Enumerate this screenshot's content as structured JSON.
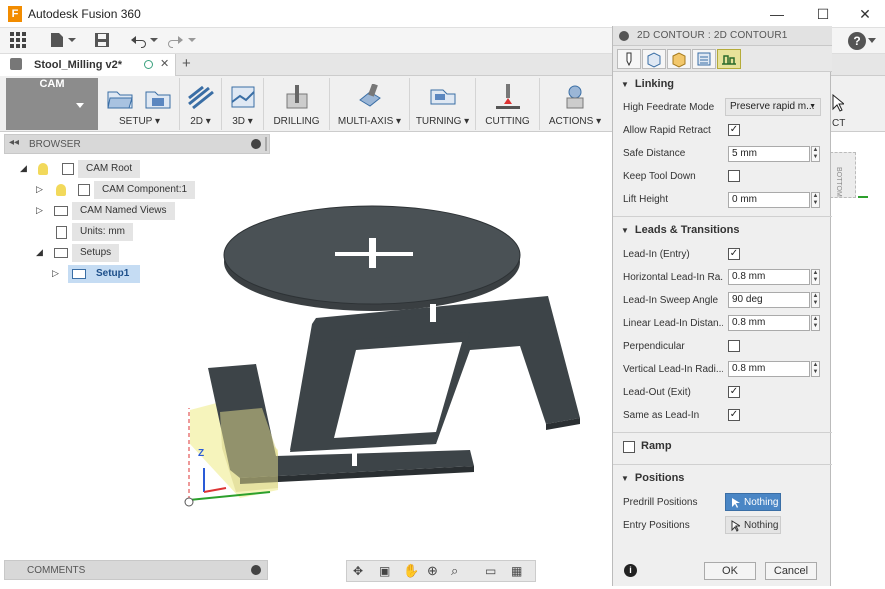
{
  "app": {
    "logo": "F",
    "title": "Autodesk Fusion 360",
    "minimize": "—",
    "maximize": "☐",
    "close": "✕"
  },
  "quick_toolbar": {
    "help": "?"
  },
  "document_tab": {
    "name": "Stool_Milling v2*",
    "close": "✕",
    "add": "+"
  },
  "ribbon": {
    "workspace": "CAM",
    "groups": [
      {
        "label": "SETUP ▾"
      },
      {
        "label": "2D ▾"
      },
      {
        "label": "3D ▾"
      },
      {
        "label": "DRILLING"
      },
      {
        "label": "MULTI-AXIS ▾"
      },
      {
        "label": "TURNING ▾"
      },
      {
        "label": "CUTTING"
      },
      {
        "label": "ACTIONS ▾"
      }
    ],
    "overflow_label": "CT"
  },
  "browser": {
    "title": "BROWSER",
    "items": [
      {
        "label": "CAM Root"
      },
      {
        "label": "CAM Component:1"
      },
      {
        "label": "CAM Named Views"
      },
      {
        "label": "Units: mm"
      },
      {
        "label": "Setups"
      },
      {
        "label": "Setup1"
      }
    ]
  },
  "comments": {
    "title": "COMMENTS"
  },
  "viewcube": {
    "face": "BOTTOM"
  },
  "axis": {
    "z": "Z"
  },
  "dialog": {
    "title": "2D CONTOUR : 2D CONTOUR1",
    "linking": {
      "title": "Linking",
      "high_feedrate_label": "High Feedrate Mode",
      "high_feedrate_value": "Preserve rapid m...",
      "allow_rapid_label": "Allow Rapid Retract",
      "safe_distance_label": "Safe Distance",
      "safe_distance_value": "5 mm",
      "keep_tool_down_label": "Keep Tool Down",
      "lift_height_label": "Lift Height",
      "lift_height_value": "0 mm"
    },
    "leads": {
      "title": "Leads & Transitions",
      "lead_in_label": "Lead-In (Entry)",
      "horiz_radius_label": "Horizontal Lead-In Ra...",
      "horiz_radius_value": "0.8 mm",
      "sweep_label": "Lead-In Sweep Angle",
      "sweep_value": "90 deg",
      "linear_label": "Linear Lead-In Distan...",
      "linear_value": "0.8 mm",
      "perp_label": "Perpendicular",
      "vert_radius_label": "Vertical Lead-In Radi...",
      "vert_radius_value": "0.8 mm",
      "lead_out_label": "Lead-Out (Exit)",
      "same_label": "Same as Lead-In"
    },
    "ramp": {
      "title": "Ramp"
    },
    "positions": {
      "title": "Positions",
      "predrill_label": "Predrill Positions",
      "predrill_value": "Nothing",
      "entry_label": "Entry Positions",
      "entry_value": "Nothing"
    },
    "ok": "OK",
    "cancel": "Cancel",
    "info": "i"
  },
  "colors": {
    "accent": "#4a86c5",
    "model": "#3d4448",
    "workspace": "#8c8c8c"
  }
}
